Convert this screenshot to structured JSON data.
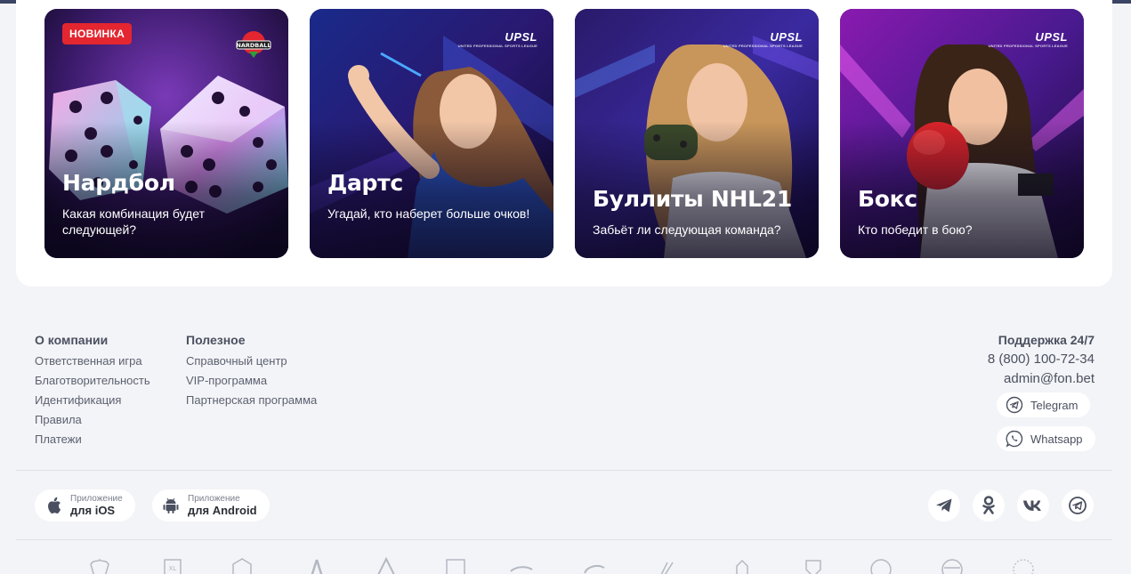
{
  "cards": [
    {
      "title": "Нардбол",
      "desc": "Какая комбинация будет следующей?",
      "badge": "НОВИНКА",
      "brand": "NARDBALL"
    },
    {
      "title": "Дартс",
      "desc": "Угадай, кто наберет больше очков!",
      "brand": "UPSL"
    },
    {
      "title": "Буллиты NHL21",
      "desc": "Забьёт ли следующая команда?",
      "brand": "UPSL"
    },
    {
      "title": "Бокс",
      "desc": "Кто победит в бою?",
      "brand": "UPSL"
    }
  ],
  "footer": {
    "company": {
      "title": "О компании",
      "links": [
        "Ответственная игра",
        "Благотворительность",
        "Идентификация",
        "Правила",
        "Платежи"
      ]
    },
    "useful": {
      "title": "Полезное",
      "links": [
        "Справочный центр",
        "VIP-программа",
        "Партнерская программа"
      ]
    },
    "support": {
      "title": "Поддержка 24/7",
      "phone": "8 (800) 100-72-34",
      "email": "admin@fon.bet",
      "telegram": "Telegram",
      "whatsapp": "Whatsapp"
    }
  },
  "apps": {
    "ios": {
      "small": "Приложение",
      "big": "для iOS"
    },
    "android": {
      "small": "Приложение",
      "big": "для Android"
    }
  },
  "social_icons": [
    "telegram-icon",
    "odnoklassniki-icon",
    "vk-icon",
    "telegram-channel-icon"
  ],
  "partner_logos": [
    "russia-emblem",
    "khl",
    "cska",
    "lokomotiv",
    "krylia-sovetov",
    "rpl",
    "club-logo-7",
    "club-logo-8",
    "club-logo-9",
    "club-logo-10",
    "club-logo-11",
    "club-logo-12",
    "club-logo-13",
    "club-logo-14"
  ],
  "colors": {
    "background": "#f3f4f7",
    "badge": "#e3262f",
    "text": "#2b2f36",
    "muted": "#5c6170"
  }
}
